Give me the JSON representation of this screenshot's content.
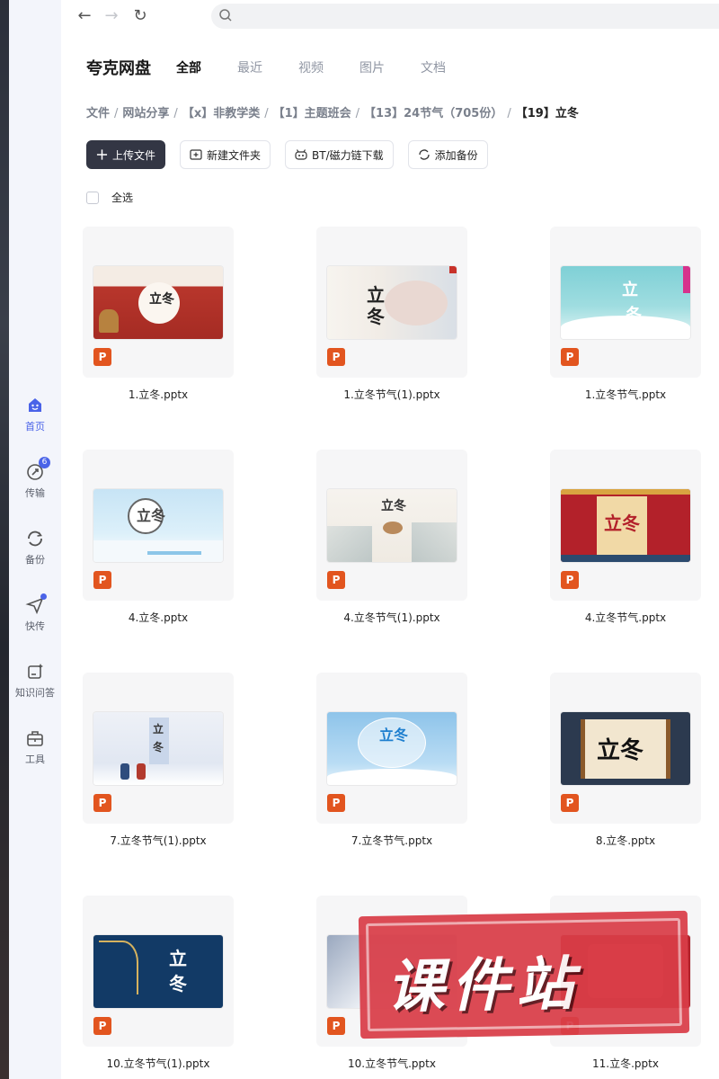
{
  "nav": {
    "items": [
      {
        "label": "首页",
        "icon": "home-icon",
        "active": true
      },
      {
        "label": "传输",
        "icon": "transfer-icon",
        "badge": "6"
      },
      {
        "label": "备份",
        "icon": "backup-icon"
      },
      {
        "label": "快传",
        "icon": "quick-send-icon",
        "dot": true
      },
      {
        "label": "知识问答",
        "icon": "knowledge-qa-icon"
      },
      {
        "label": "工具",
        "icon": "toolbox-icon"
      }
    ]
  },
  "browser": {
    "back_icon": "back-arrow-icon",
    "forward_icon": "forward-arrow-icon",
    "reload_icon": "reload-icon",
    "search_icon": "search-icon",
    "url_placeholder": ""
  },
  "header": {
    "brand": "夸克网盘",
    "tabs": [
      "全部",
      "最近",
      "视频",
      "图片",
      "文档"
    ],
    "active_tab": "全部"
  },
  "breadcrumb": [
    "文件",
    "网站分享",
    "【x】非教学类",
    "【1】主题班会",
    "【13】24节气（705份）",
    "【19】立冬"
  ],
  "toolbar": {
    "upload": "上传文件",
    "new_folder": "新建文件夹",
    "bt_download": "BT/磁力链下载",
    "add_backup": "添加备份"
  },
  "select_all": "全选",
  "files": [
    {
      "name": "1.立冬.pptx",
      "type": "P"
    },
    {
      "name": "1.立冬节气(1).pptx",
      "type": "P"
    },
    {
      "name": "1.立冬节气.pptx",
      "type": "P"
    },
    {
      "name": "4.立冬.pptx",
      "type": "P"
    },
    {
      "name": "4.立冬节气(1).pptx",
      "type": "P"
    },
    {
      "name": "4.立冬节气.pptx",
      "type": "P"
    },
    {
      "name": "7.立冬节气(1).pptx",
      "type": "P"
    },
    {
      "name": "7.立冬节气.pptx",
      "type": "P"
    },
    {
      "name": "8.立冬.pptx",
      "type": "P"
    },
    {
      "name": "10.立冬节气(1).pptx",
      "type": "P"
    },
    {
      "name": "10.立冬节气.pptx",
      "type": "P"
    },
    {
      "name": "11.立冬.pptx",
      "type": "P"
    }
  ],
  "watermark": "课件站",
  "colors": {
    "accent": "#4a63e8",
    "primary_button": "#333644",
    "ppt": "#e2551f",
    "watermark": "#d93d48"
  }
}
